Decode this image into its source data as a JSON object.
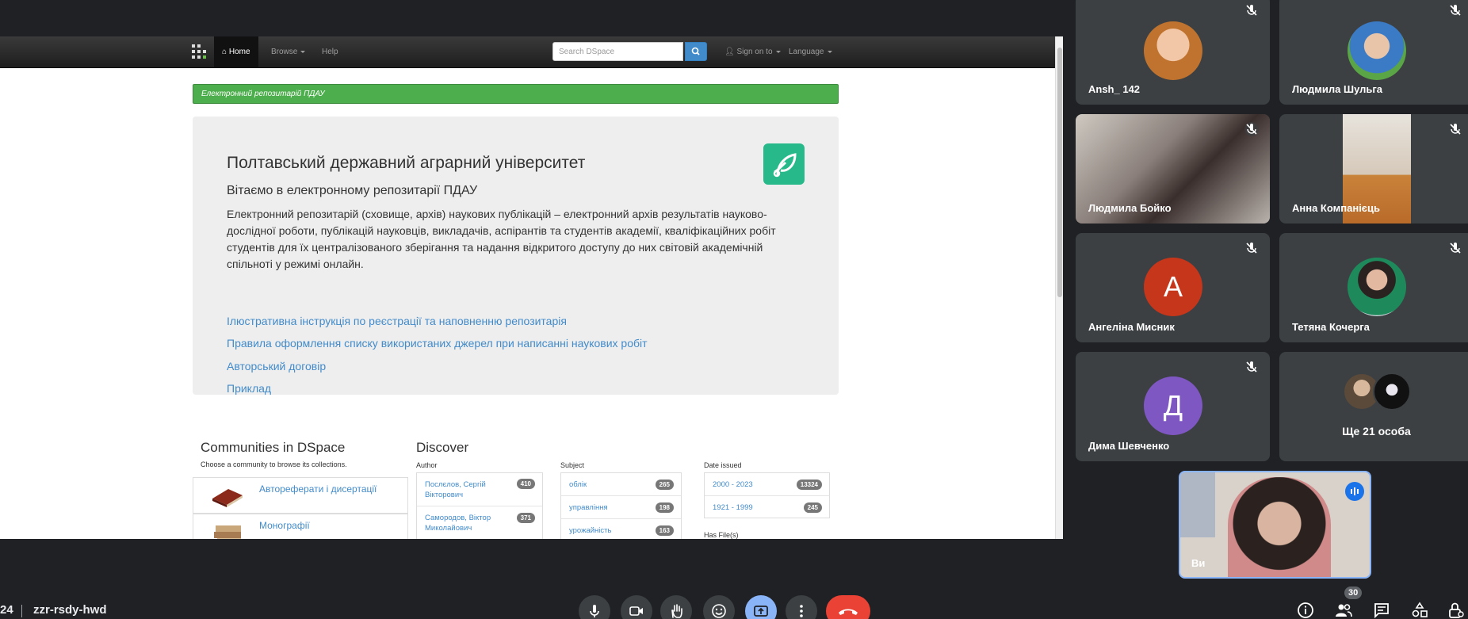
{
  "browser": {
    "nav": {
      "home": "Home",
      "browse": "Browse",
      "help": "Help",
      "search_placeholder": "Search DSpace",
      "sign_on": "Sign on to",
      "language": "Language"
    },
    "banner": "Електронний репозитарій ПДАУ",
    "jumbotron": {
      "title": "Полтавський державний аграрний університет",
      "subtitle": "Вітаємо в електронному репозитарії ПДАУ",
      "text": "Електронний репозитарій (сховище, архів) наукових публікацій – електронний архів результатів науково-дослідної роботи, публікацій науковців, викладачів, аспірантів та студентів академії, кваліфікаційних робіт студентів для їх централізованого зберігання та надання відкритого доступу до них світовій академічній спільноті у режимі онлайн.",
      "links": [
        "Ілюстративна інструкція по реєстрації та наповненню репозитарія",
        "Правила оформлення списку використаних джерел при написанні наукових робіт",
        "Авторський договір",
        "Приклад"
      ]
    },
    "communities": {
      "heading": "Communities in DSpace",
      "subheading": "Choose a community to browse its collections.",
      "items": [
        "Автореферати і дисертації",
        "Монографії"
      ]
    },
    "discover": {
      "heading": "Discover",
      "author": {
        "label": "Author",
        "items": [
          {
            "name": "Послєлов, Сергій Вікторович",
            "count": "410"
          },
          {
            "name": "Самородов, Віктор Миколайович",
            "count": "371"
          }
        ]
      },
      "subject": {
        "label": "Subject",
        "items": [
          {
            "name": "облік",
            "count": "265"
          },
          {
            "name": "управління",
            "count": "198"
          },
          {
            "name": "урожайність",
            "count": "163"
          }
        ]
      },
      "date": {
        "label": "Date issued",
        "items": [
          {
            "name": "2000 - 2023",
            "count": "13324"
          },
          {
            "name": "1921 - 1999",
            "count": "245"
          }
        ],
        "has_files": "Has File(s)"
      }
    }
  },
  "participants": [
    {
      "name": "Ansh_ 142",
      "type": "photo",
      "muted": true
    },
    {
      "name": "Людмила Шульга",
      "type": "photo",
      "muted": true
    },
    {
      "name": "Людмила Бойко",
      "type": "video",
      "muted": true
    },
    {
      "name": "Анна Компанієць",
      "type": "video",
      "muted": true
    },
    {
      "name": "Ангеліна Мисник",
      "type": "letter",
      "letter": "А",
      "color": "#c5361b",
      "muted": true
    },
    {
      "name": "Тетяна Кочерга",
      "type": "photo",
      "muted": true
    },
    {
      "name": "Дима Шевченко",
      "type": "letter",
      "letter": "Д",
      "color": "#7e57c2",
      "muted": true
    },
    {
      "name": "Ще 21 особа",
      "type": "more"
    }
  ],
  "self_view": {
    "name": "Ви"
  },
  "bottom": {
    "time": "24",
    "meeting_code": "zzr-rsdy-hwd",
    "people_count": "30"
  },
  "colors": {
    "meet_bg": "#202124",
    "tile_bg": "#3c4043",
    "end_call": "#ea4335",
    "present_active": "#8ab4f8",
    "banner_green": "#4cae4c",
    "link_blue": "#428bca"
  }
}
